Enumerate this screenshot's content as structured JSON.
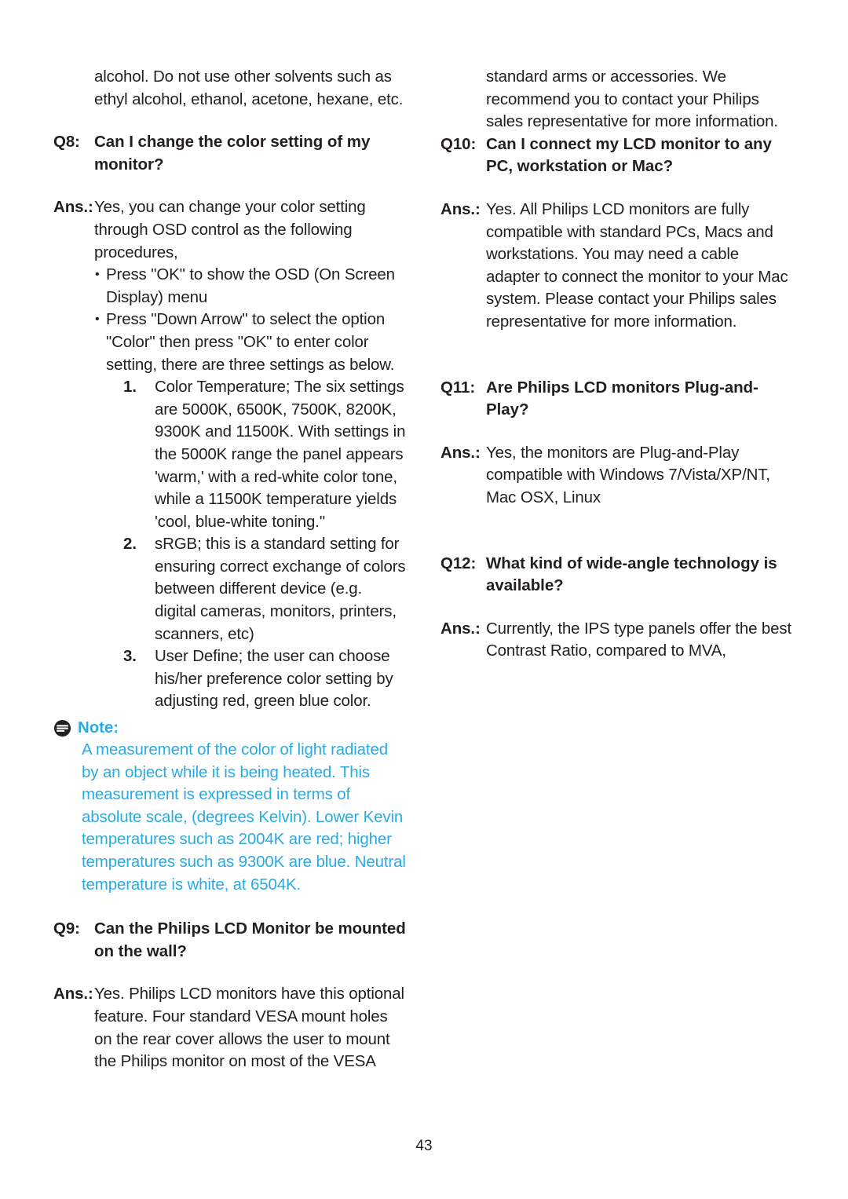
{
  "document": {
    "page_number": "43",
    "note_accent_color": "#29ABE2",
    "text_color": "#231f20"
  },
  "left_column": {
    "intro_continuation": [
      "alcohol. Do not use other solvents such as",
      "ethyl alcohol, ethanol, acetone, hexane, etc."
    ],
    "q8": {
      "label": "Q8:",
      "question": "Can I change the color setting of my monitor?",
      "ans_label": "Ans.:",
      "answer": "Yes, you can change your color setting through OSD control as the following procedures,",
      "bullets": [
        "Press \"OK\" to show the OSD (On Screen Display) menu",
        "Press \"Down Arrow\" to select the option \"Color\" then press \"OK\" to enter color setting, there are three settings as below."
      ],
      "numbered": [
        {
          "num": "1.",
          "text": "Color Temperature; The six settings are 5000K, 6500K, 7500K, 8200K, 9300K and 11500K. With settings in the 5000K range the panel appears 'warm,' with a red-white color tone, while a 11500K temperature yields 'cool, blue-white toning.\""
        },
        {
          "num": "2.",
          "text": "sRGB; this is a standard setting for ensuring correct exchange of colors between different device (e.g. digital cameras, monitors, printers, scanners, etc)"
        },
        {
          "num": "3.",
          "text": "User Define; the user can choose his/her preference color setting by adjusting red, green blue color."
        }
      ]
    },
    "note": {
      "icon": "note-circle-icon",
      "title": "Note:",
      "body": "A measurement of the color of light radiated by an object while it is being heated. This measurement is expressed in terms of absolute scale, (degrees Kelvin). Lower Kevin temperatures such as 2004K are red; higher temperatures such as 9300K are blue. Neutral temperature is white, at 6504K."
    },
    "q9": {
      "label": "Q9:",
      "question": "Can the Philips LCD Monitor be  mounted on the wall?",
      "ans_label": "Ans.:",
      "answer": "Yes. Philips LCD monitors have this optional feature. Four standard VESA mount holes on the rear cover allows the user to mount the Philips monitor on most of the VESA"
    }
  },
  "right_column": {
    "intro_continuation": "standard arms or accessories. We recommend you to contact your Philips sales representative for more information.",
    "q10": {
      "label": "Q10:",
      "question": "Can I connect my LCD monitor to any PC, workstation or Mac?",
      "ans_label": "Ans.:",
      "answer": "Yes. All Philips LCD monitors are fully compatible with standard PCs, Macs and workstations. You may need a cable adapter to connect the monitor to your Mac system. Please contact your Philips sales representative for more information."
    },
    "q11": {
      "label": "Q11:",
      "question": "Are Philips LCD monitors Plug-and- Play?",
      "ans_label": "Ans.:",
      "answer": "Yes, the monitors are Plug-and-Play compatible with Windows 7/Vista/XP/NT, Mac OSX, Linux"
    },
    "q12": {
      "label": "Q12:",
      "question": "What kind of wide-angle technology is available?",
      "ans_label": "Ans.:",
      "answer": "Currently, the IPS type panels offer the best Contrast Ratio, compared to MVA,"
    }
  }
}
